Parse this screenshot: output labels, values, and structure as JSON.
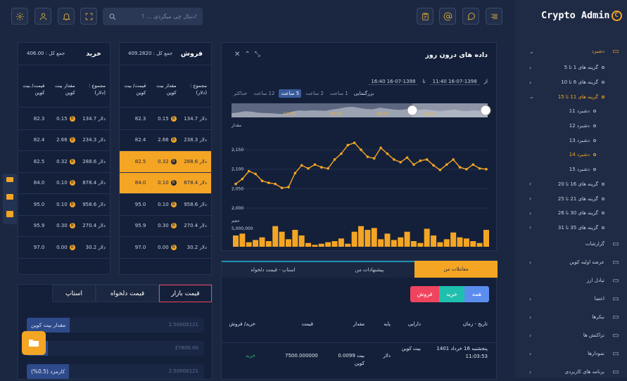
{
  "brand": {
    "name": "Crypto Admin",
    "mark": "C"
  },
  "search": {
    "placeholder": "دنبال چی میگردی ... ؟!"
  },
  "sidebar": {
    "items": [
      {
        "label": "دشبرد",
        "level": "top",
        "active": true,
        "chevron": "⌄",
        "icon": "monitor-icon"
      },
      {
        "label": "گزینه های 1 تا 5",
        "level": "sub1",
        "chevron": "›"
      },
      {
        "label": "گزینه های 6 تا 10",
        "level": "sub1",
        "chevron": "›"
      },
      {
        "label": "گزینه های 11 تا 15",
        "level": "sub1",
        "active": true,
        "chevron": "⌄"
      },
      {
        "label": "دشبرد 11",
        "level": "sub2"
      },
      {
        "label": "دشبرد 12",
        "level": "sub2"
      },
      {
        "label": "دشبرد 13",
        "level": "sub2"
      },
      {
        "label": "دشبرد 14",
        "level": "sub2",
        "active": true
      },
      {
        "label": "دشبرد 15",
        "level": "sub2"
      },
      {
        "label": "گزینه های 16 تا 20",
        "level": "sub1",
        "chevron": "›"
      },
      {
        "label": "گزینه های 21 تا 25",
        "level": "sub1",
        "chevron": "›"
      },
      {
        "label": "گزینه های 30 تا 26",
        "level": "sub1",
        "chevron": "›"
      },
      {
        "label": "گزینه های 35 تا 31",
        "level": "sub1",
        "chevron": "›"
      },
      {
        "label": "گزارشات",
        "level": "top",
        "chevron": "",
        "icon": "bars-icon"
      },
      {
        "label": "عرضه اولیه کوین",
        "level": "top",
        "chevron": "›",
        "icon": "target-icon"
      },
      {
        "label": "تبادل ارز",
        "level": "top",
        "chevron": "",
        "icon": "refresh-icon"
      },
      {
        "label": "اعضا",
        "level": "top",
        "chevron": "›",
        "icon": "users-icon"
      },
      {
        "label": "نیکرها",
        "level": "top",
        "chevron": "›",
        "icon": "sliders-icon"
      },
      {
        "label": "تراکنش ها",
        "level": "top",
        "chevron": "›",
        "icon": "dollar-icon"
      },
      {
        "label": "نمودارها",
        "level": "top",
        "chevron": "›",
        "icon": "chart-icon"
      },
      {
        "label": "برنامه های کاربردی",
        "level": "top",
        "chevron": "›",
        "icon": "grid-icon"
      }
    ]
  },
  "sell": {
    "title": "فروش",
    "total": "جمع کل : 409.2820",
    "cols": [
      "قیمت/ بیت کوین",
      "مقدار بیت کوین",
      "مجموع : (دلار)"
    ],
    "rows": [
      {
        "price": "82.3",
        "amount": "0.15",
        "total": "134.7 دلار"
      },
      {
        "price": "82.4",
        "amount": "2.66",
        "total": "238.3 دلار"
      },
      {
        "price": "82.5",
        "amount": "0.32",
        "total": "288.6 دلار",
        "hl": true
      },
      {
        "price": "84.0",
        "amount": "0.10",
        "total": "878.4 دلار",
        "hl": true
      },
      {
        "price": "95.0",
        "amount": "0.10",
        "total": "958.6 دلار"
      },
      {
        "price": "95.9",
        "amount": "0.30",
        "total": "270.4 دلار"
      },
      {
        "price": "97.0",
        "amount": "0.00",
        "total": "30.2 دلار"
      }
    ]
  },
  "buy": {
    "title": "خرید",
    "total": "جمع کل : 406.00",
    "cols": [
      "قیمت/ بیت کوین",
      "مقدار بیت کوین",
      "مجموع : (دلار)"
    ],
    "rows": [
      {
        "price": "82.3",
        "amount": "0.15",
        "total": "134.7 دلار"
      },
      {
        "price": "82.4",
        "amount": "2.66",
        "total": "234.3 دلار"
      },
      {
        "price": "82.5",
        "amount": "0.32",
        "total": "288.6 دلار"
      },
      {
        "price": "84.0",
        "amount": "0.10",
        "total": "878.4 دلار"
      },
      {
        "price": "95.0",
        "amount": "0.10",
        "total": "958.6 دلار"
      },
      {
        "price": "95.9",
        "amount": "0.30",
        "total": "270.4 دلار"
      },
      {
        "price": "97.0",
        "amount": "0.00",
        "total": "30.2 دلار"
      }
    ]
  },
  "intraday": {
    "title": "داده های درون روز",
    "from_label": "از",
    "from_value": "16-07-1398 11:40",
    "to_label": "تا",
    "to_value": "16-07-1398 16:40",
    "zoom_label": "بزرگنمایی",
    "zoom_options": [
      "1 ساعت",
      "2 ساعت",
      "5 ساعت",
      "12 ساعت",
      "حداکثر"
    ],
    "zoom_active": 2,
    "nav_ticks": [
      "02:00",
      "06:00",
      "09:00",
      "12:00"
    ],
    "ylabel": "مقدار",
    "vol_label": "حجم",
    "vol_tick": "5,000,000"
  },
  "chart_data": {
    "type": "line",
    "yticks": [
      "2,000",
      "2,050",
      "2,100",
      "2,150"
    ],
    "ylim": [
      2000,
      2190
    ],
    "values": [
      2062,
      2075,
      2095,
      2088,
      2070,
      2065,
      2062,
      2052,
      2054,
      2090,
      2110,
      2102,
      2112,
      2105,
      2102,
      2125,
      2140,
      2162,
      2168,
      2150,
      2132,
      2128,
      2155,
      2140,
      2125,
      2118,
      2130,
      2112,
      2122,
      2125,
      2110,
      2098,
      2112,
      2125,
      2105,
      2100,
      2112,
      2102,
      2100
    ],
    "volume": [
      30,
      35,
      12,
      18,
      25,
      15,
      55,
      40,
      20,
      45,
      30,
      10,
      5,
      8,
      12,
      15,
      22,
      8,
      40,
      55,
      45,
      50,
      20,
      35,
      18,
      25,
      40,
      15,
      10,
      48,
      30,
      12,
      20,
      38,
      25,
      22,
      15,
      10,
      45
    ],
    "volume_max": 60
  },
  "trade_tabs": [
    "معاملات من",
    "پیشنهادات من",
    "استاپ - قیمت دلخواه"
  ],
  "trade_tabs_active": 0,
  "filters": [
    "همه",
    "خرید",
    "فروش"
  ],
  "trades": {
    "cols": [
      "تاریخ - زمان",
      "دارایی",
      "پایه",
      "مقدار",
      "قیمت",
      "خرید/ فروش"
    ],
    "rows": [
      {
        "date": "پنجشنبه 16 خرداد 1401 11:03:53",
        "asset": "بیت کوین",
        "base": "دلار",
        "amount": "0.0099 بیت کوین",
        "price": "7500.000000",
        "side": "خرید"
      }
    ]
  },
  "order_tabs": [
    "قیمت بازار",
    "قیمت دلخواه",
    "استاپ"
  ],
  "order_tabs_active": 0,
  "order_fields": [
    {
      "label": "مقدار بیت کوین",
      "value": "2.50000121"
    },
    {
      "label": "قیمت",
      "value": "27800.00"
    },
    {
      "label": "کارمزد (0.5%)",
      "value": "2.50000121"
    }
  ]
}
